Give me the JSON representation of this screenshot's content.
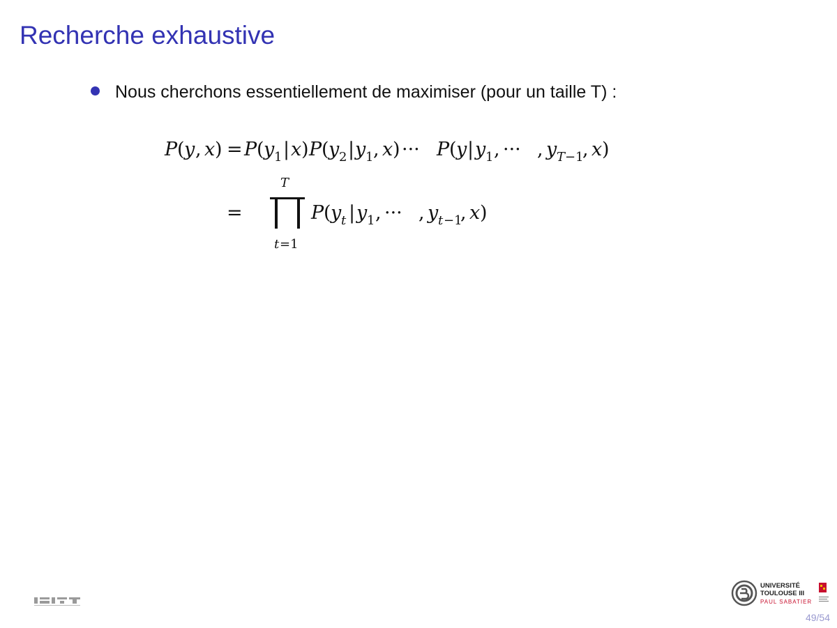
{
  "slide": {
    "title": "Recherche exhaustive",
    "bullet": "Nous cherchons essentiellement de maximiser (pour un taille T) :"
  },
  "equation": {
    "line1_lhs": "P(y, x)",
    "line1_rhs": "= P(y₁|x)P(y₂|y₁, x)···P(y|y₁, ··· , y_{T−1}, x)",
    "line2_rhs": "= ∏_{t=1}^{T} P(y_t|y₁, ··· , y_{t−1}, x)"
  },
  "logos": {
    "left": "IRIT",
    "right_line1": "UNIVERSITÉ",
    "right_line2": "TOULOUSE III",
    "right_line3": "PAUL SABATIER"
  },
  "footer": {
    "page": "49/54"
  },
  "colors": {
    "title": "#3333b3",
    "bullet": "#3333b3",
    "page_number": "#9a9ad0"
  }
}
